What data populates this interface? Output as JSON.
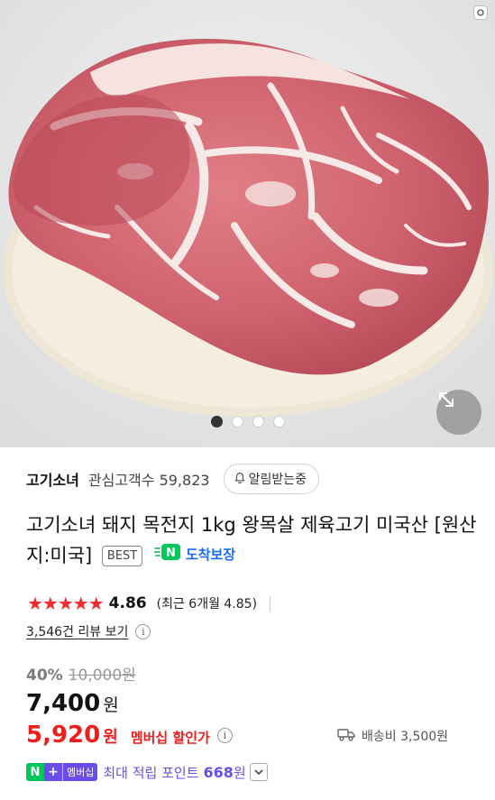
{
  "product_image": {
    "alt": "",
    "pagination": {
      "total": 4,
      "current": 1
    }
  },
  "store": {
    "name": "고기소녀",
    "fans_label": "관심고객수 59,823",
    "notify_label": "알림받는중"
  },
  "product": {
    "title": "고기소녀 돼지 목전지 1kg 왕목살 제육고기 미국산 [원산지:미국]",
    "best_badge": "BEST",
    "arrival_badge": "도착보장",
    "arrival_badge_icon": "N"
  },
  "rating": {
    "stars": "★★★★★",
    "score": "4.86",
    "recent": "(최근 6개월 4.85)",
    "review_link": "3,546건 리뷰 보기"
  },
  "pricing": {
    "discount_rate": "40%",
    "original_price": "10,000원",
    "price": "7,400",
    "price_unit": "원",
    "member_price": "5,920",
    "member_unit": "원",
    "member_label": "멤버십 할인가",
    "shipping": "배송비 3,500원"
  },
  "points": {
    "badge_n": "N",
    "badge_plus": "+",
    "badge_label": "멤버십",
    "text": "최대 적립 포인트",
    "value": "668",
    "unit": "원"
  },
  "colors": {
    "accent_red": "#f01d1d",
    "naver_green": "#03c75a",
    "membership_purple": "#6b4eea",
    "arrival_blue": "#1a6ef5"
  },
  "icons": [
    "lens-icon",
    "expand-icon",
    "bell-icon",
    "info-icon",
    "truck-icon",
    "chevron-down-icon"
  ]
}
